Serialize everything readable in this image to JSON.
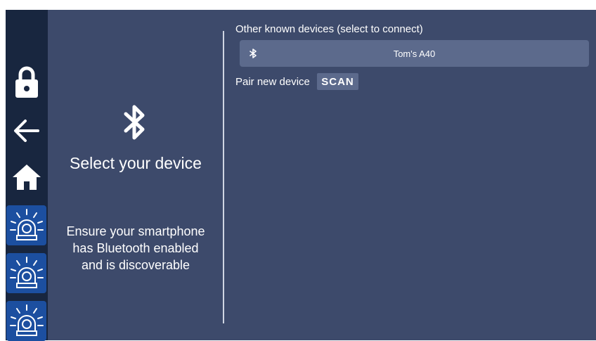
{
  "sidebar": {
    "icons": [
      "lock-icon",
      "back-arrow-icon",
      "home-icon",
      "alarm-light-icon",
      "alarm-light-icon",
      "alarm-light-icon"
    ]
  },
  "left_panel": {
    "icon": "bluetooth-icon",
    "title": "Select your device",
    "hint": "Ensure your smartphone has Bluetooth enabled and is discoverable"
  },
  "right_panel": {
    "known_devices_label": "Other known devices (select to connect)",
    "devices": [
      {
        "name": "Tom's A40",
        "icon": "bluetooth-icon"
      }
    ],
    "pair_label": "Pair new device",
    "scan_label": "SCAN"
  },
  "colors": {
    "background": "#3d4a6b",
    "sidebar": "#18263f",
    "alarm_button": "#1c4fa0",
    "device_row": "#5c6a8c",
    "text": "#ffffff"
  }
}
